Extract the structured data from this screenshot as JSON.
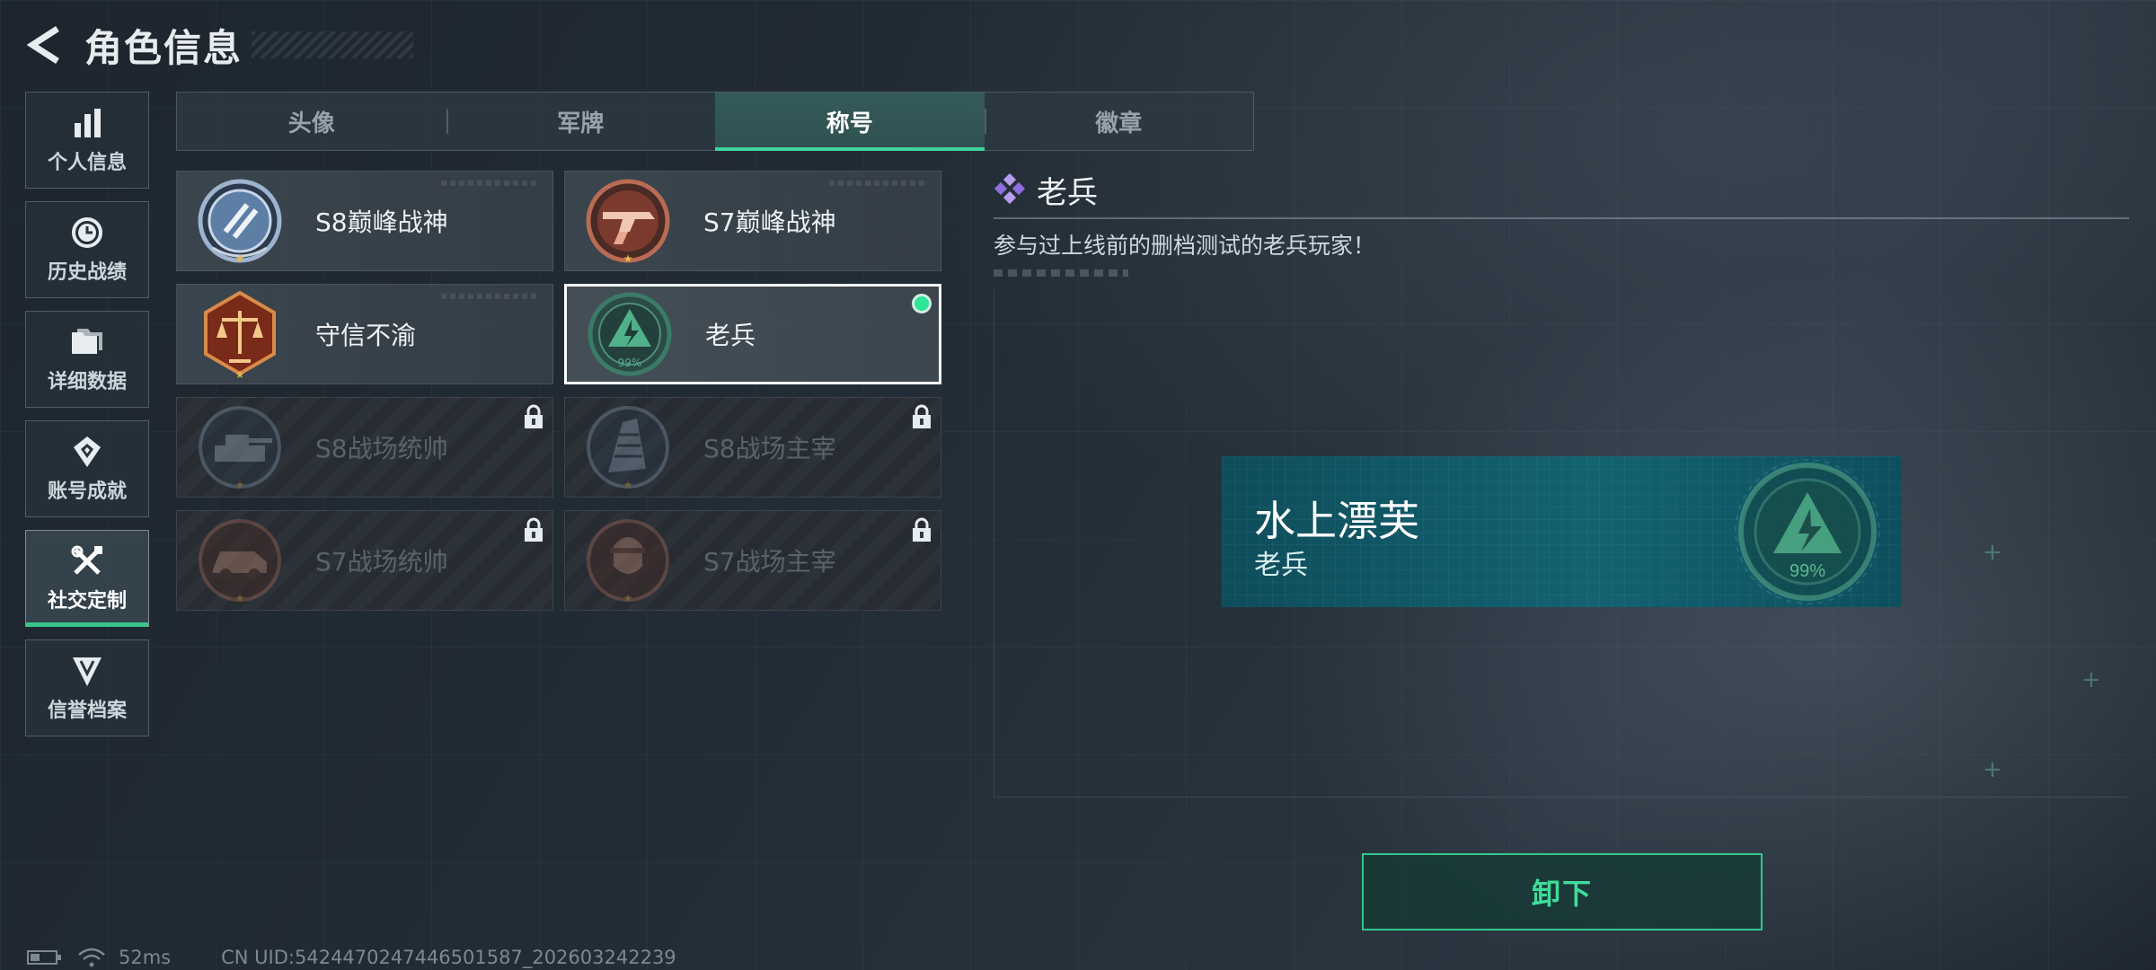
{
  "header": {
    "title": "角色信息"
  },
  "sidebar": {
    "items": [
      {
        "label": "个人信息",
        "icon": "bar-chart-icon",
        "active": false
      },
      {
        "label": "历史战绩",
        "icon": "clock-icon",
        "active": false
      },
      {
        "label": "详细数据",
        "icon": "folder-icon",
        "active": false
      },
      {
        "label": "账号成就",
        "icon": "achievement-icon",
        "active": false
      },
      {
        "label": "社交定制",
        "icon": "tools-icon",
        "active": true
      },
      {
        "label": "信誉档案",
        "icon": "shield-emblem-icon",
        "active": false
      }
    ]
  },
  "tabs": [
    {
      "label": "头像",
      "active": false
    },
    {
      "label": "军牌",
      "active": false
    },
    {
      "label": "称号",
      "active": true
    },
    {
      "label": "徽章",
      "active": false
    }
  ],
  "titles": [
    {
      "name": "S8巅峰战神",
      "icon": "s8-peak-emblem-icon",
      "locked": false,
      "selected": false
    },
    {
      "name": "S7巅峰战神",
      "icon": "s7-peak-emblem-icon",
      "locked": false,
      "selected": false
    },
    {
      "name": "守信不渝",
      "icon": "scales-emblem-icon",
      "locked": false,
      "selected": false
    },
    {
      "name": "老兵",
      "icon": "veteran-emblem-icon",
      "locked": false,
      "selected": true,
      "equipped": true
    },
    {
      "name": "S8战场统帅",
      "icon": "tank-emblem-icon",
      "locked": true,
      "selected": false
    },
    {
      "name": "S8战场主宰",
      "icon": "tower-emblem-icon",
      "locked": true,
      "selected": false
    },
    {
      "name": "S7战场统帅",
      "icon": "vehicle-emblem-icon",
      "locked": true,
      "selected": false
    },
    {
      "name": "S7战场主宰",
      "icon": "soldier-emblem-icon",
      "locked": true,
      "selected": false
    }
  ],
  "detail": {
    "name": "老兵",
    "description": "参与过上线前的删档测试的老兵玩家！",
    "rarity_color": "#9b7be0"
  },
  "nameplate": {
    "player_name": "水上漂芙",
    "title": "老兵",
    "emblem_text": "99%"
  },
  "emblem_text": "99%",
  "actions": {
    "unequip": "卸下"
  },
  "status": {
    "ping": "52ms",
    "uid": "CN UID:5424470247446501587_202603242239"
  },
  "colors": {
    "accent_green": "#3fd49a",
    "plate_teal": "#126270"
  }
}
